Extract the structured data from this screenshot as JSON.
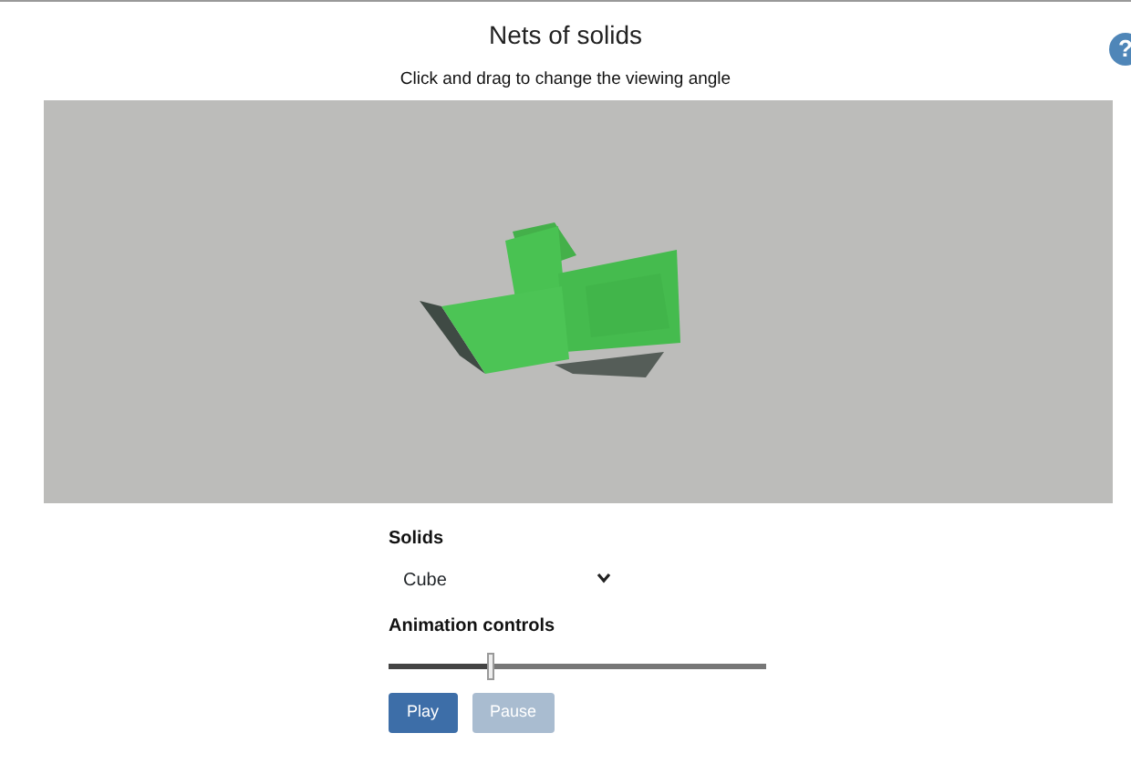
{
  "title": "Nets of solids",
  "help": {
    "label": "?"
  },
  "instruction": "Click and drag to change the viewing angle",
  "solids": {
    "label": "Solids",
    "value": "Cube"
  },
  "animation": {
    "label": "Animation controls",
    "level": 0.27,
    "buttons": [
      {
        "label": "Play",
        "disabled": false
      },
      {
        "label": "Pause",
        "disabled": true
      }
    ]
  }
}
